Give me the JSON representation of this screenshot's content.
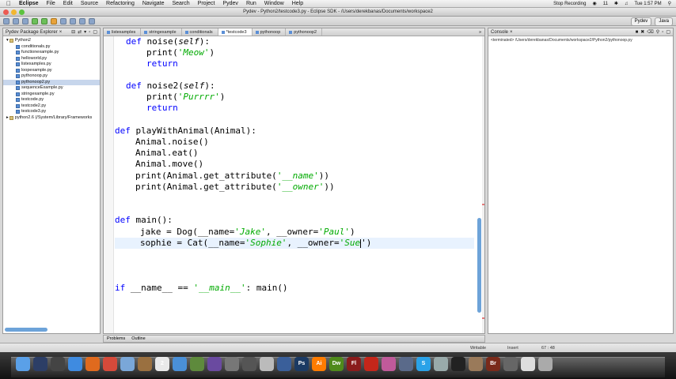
{
  "menubar": {
    "apple": "",
    "items": [
      "Eclipse",
      "File",
      "Edit",
      "Source",
      "Refactoring",
      "Navigate",
      "Search",
      "Project",
      "Pydev",
      "Run",
      "Window",
      "Help"
    ],
    "recording": "Stop Recording",
    "wifi_label": "11",
    "clock": "Tue 1:57 PM"
  },
  "window": {
    "title": "Pydev - Python2/testcode3.py - Eclipse SDK - /Users/derekbanas/Documents/workspace2"
  },
  "toolbar": {
    "perspectives": [
      "Pydev",
      "Java"
    ]
  },
  "explorer": {
    "title": "Pydev Package Explorer",
    "items": [
      {
        "label": "Python2",
        "type": "folder",
        "indent": 0
      },
      {
        "label": "conditionals.py",
        "type": "py",
        "indent": 1
      },
      {
        "label": "functionexample.py",
        "type": "py",
        "indent": 1
      },
      {
        "label": "helloworld.py",
        "type": "py",
        "indent": 1
      },
      {
        "label": "listexamples.py",
        "type": "py",
        "indent": 1
      },
      {
        "label": "loopexample.py",
        "type": "py",
        "indent": 1
      },
      {
        "label": "pythonoop.py",
        "type": "py",
        "indent": 1
      },
      {
        "label": "pythonoop2.py",
        "type": "py",
        "indent": 1,
        "selected": true
      },
      {
        "label": "sequenceExample.py",
        "type": "py",
        "indent": 1
      },
      {
        "label": "stringexample.py",
        "type": "py",
        "indent": 1
      },
      {
        "label": "testcode.py",
        "type": "py",
        "indent": 1
      },
      {
        "label": "testcode2.py",
        "type": "py",
        "indent": 1
      },
      {
        "label": "testcode3.py",
        "type": "py",
        "indent": 1
      },
      {
        "label": "python2.6  (/System/Library/Frameworks",
        "type": "folder",
        "indent": 0
      }
    ]
  },
  "editor": {
    "tabs": [
      {
        "label": "listexamples",
        "active": false
      },
      {
        "label": "stringexample",
        "active": false
      },
      {
        "label": "conditionals",
        "active": false
      },
      {
        "label": "*testcode3",
        "active": true
      },
      {
        "label": "pythonoop",
        "active": false
      },
      {
        "label": "pythonoop2",
        "active": false
      }
    ],
    "more": "»"
  },
  "code": {
    "l1": {
      "kw": "def",
      "name": " noise(",
      "self": "self",
      "tail": "):"
    },
    "l2": {
      "fn": "print(",
      "str": "'Meow'",
      "tail": ")"
    },
    "l3": {
      "kw": "return"
    },
    "l4": {
      "kw": "def",
      "name": " noise2(",
      "self": "self",
      "tail": "):"
    },
    "l5": {
      "fn": "print(",
      "str": "'Purrrr'",
      "tail": ")"
    },
    "l6": {
      "kw": "return"
    },
    "l7": {
      "kw": "def",
      "tail": " playWithAnimal(Animal):"
    },
    "l8": {
      "text": "Animal.noise()"
    },
    "l9": {
      "text": "Animal.eat()"
    },
    "l10": {
      "text": "Animal.move()"
    },
    "l11": {
      "a": "print(Animal.get_attribute(",
      "str": "'__name'",
      "b": "))"
    },
    "l12": {
      "a": "print(Animal.get_attribute(",
      "str": "'__owner'",
      "b": "))"
    },
    "l13": {
      "kw": "def",
      "tail": " main():"
    },
    "l14": {
      "a": "jake = Dog(__name=",
      "s1": "'Jake'",
      "b": ", __owner=",
      "s2": "'Paul'",
      "c": ")"
    },
    "l15": {
      "a": "sophie = Cat(__name=",
      "s1": "'Sophie'",
      "b": ", __owner=",
      "s2": "'Sue",
      "c": "')"
    },
    "l16": {
      "kw": "if",
      "a": " __name__ == ",
      "str": "'__main__'",
      "b": ": main()"
    }
  },
  "console": {
    "title": "Console",
    "terminated": "<terminated> /Users/derekbanas/Documents/workspace2/Python2/pythonoop.py"
  },
  "bottom": {
    "problems": "Problems",
    "outline": "Outline"
  },
  "status": {
    "writable": "Writable",
    "insert": "Insert",
    "position": "67 : 48"
  },
  "dock": {
    "apps": [
      {
        "name": "finder",
        "color": "#5aa0e8",
        "label": ""
      },
      {
        "name": "dashboard",
        "color": "#2c3e66",
        "label": ""
      },
      {
        "name": "mission-control",
        "color": "#444",
        "label": ""
      },
      {
        "name": "safari",
        "color": "#3f8be0",
        "label": ""
      },
      {
        "name": "firefox",
        "color": "#e06a1e",
        "label": ""
      },
      {
        "name": "chrome",
        "color": "#d64a3a",
        "label": ""
      },
      {
        "name": "mail",
        "color": "#7aa7d8",
        "label": ""
      },
      {
        "name": "address-book",
        "color": "#9a7040",
        "label": ""
      },
      {
        "name": "ical",
        "color": "#e9e9e9",
        "label": "2"
      },
      {
        "name": "itunes",
        "color": "#4a90d8",
        "label": ""
      },
      {
        "name": "iphoto",
        "color": "#5e8a3c",
        "label": ""
      },
      {
        "name": "imovie",
        "color": "#6a4aa0",
        "label": ""
      },
      {
        "name": "utility",
        "color": "#777",
        "label": ""
      },
      {
        "name": "screen",
        "color": "#555",
        "label": ""
      },
      {
        "name": "textedit",
        "color": "#bbb",
        "label": ""
      },
      {
        "name": "xcode",
        "color": "#3a5f9a",
        "label": ""
      },
      {
        "name": "ps",
        "color": "#1b3a63",
        "label": "Ps"
      },
      {
        "name": "ai",
        "color": "#ff7c00",
        "label": "Ai"
      },
      {
        "name": "dw",
        "color": "#4f8a1b",
        "label": "Dw"
      },
      {
        "name": "fl",
        "color": "#8a1b1b",
        "label": "Fl"
      },
      {
        "name": "acrobat",
        "color": "#c4261a",
        "label": ""
      },
      {
        "name": "app-a",
        "color": "#c05a9a",
        "label": ""
      },
      {
        "name": "app-b",
        "color": "#5a6a8a",
        "label": ""
      },
      {
        "name": "skype",
        "color": "#2aa2e8",
        "label": "S"
      },
      {
        "name": "app-c",
        "color": "#9aa",
        "label": ""
      },
      {
        "name": "terminal",
        "color": "#222",
        "label": ""
      },
      {
        "name": "app-d",
        "color": "#9a7a5a",
        "label": ""
      },
      {
        "name": "br",
        "color": "#7a2a1a",
        "label": "Br"
      },
      {
        "name": "app-e",
        "color": "#666",
        "label": ""
      },
      {
        "name": "doc",
        "color": "#ddd",
        "label": ""
      },
      {
        "name": "trash",
        "color": "#aaa",
        "label": ""
      }
    ]
  }
}
